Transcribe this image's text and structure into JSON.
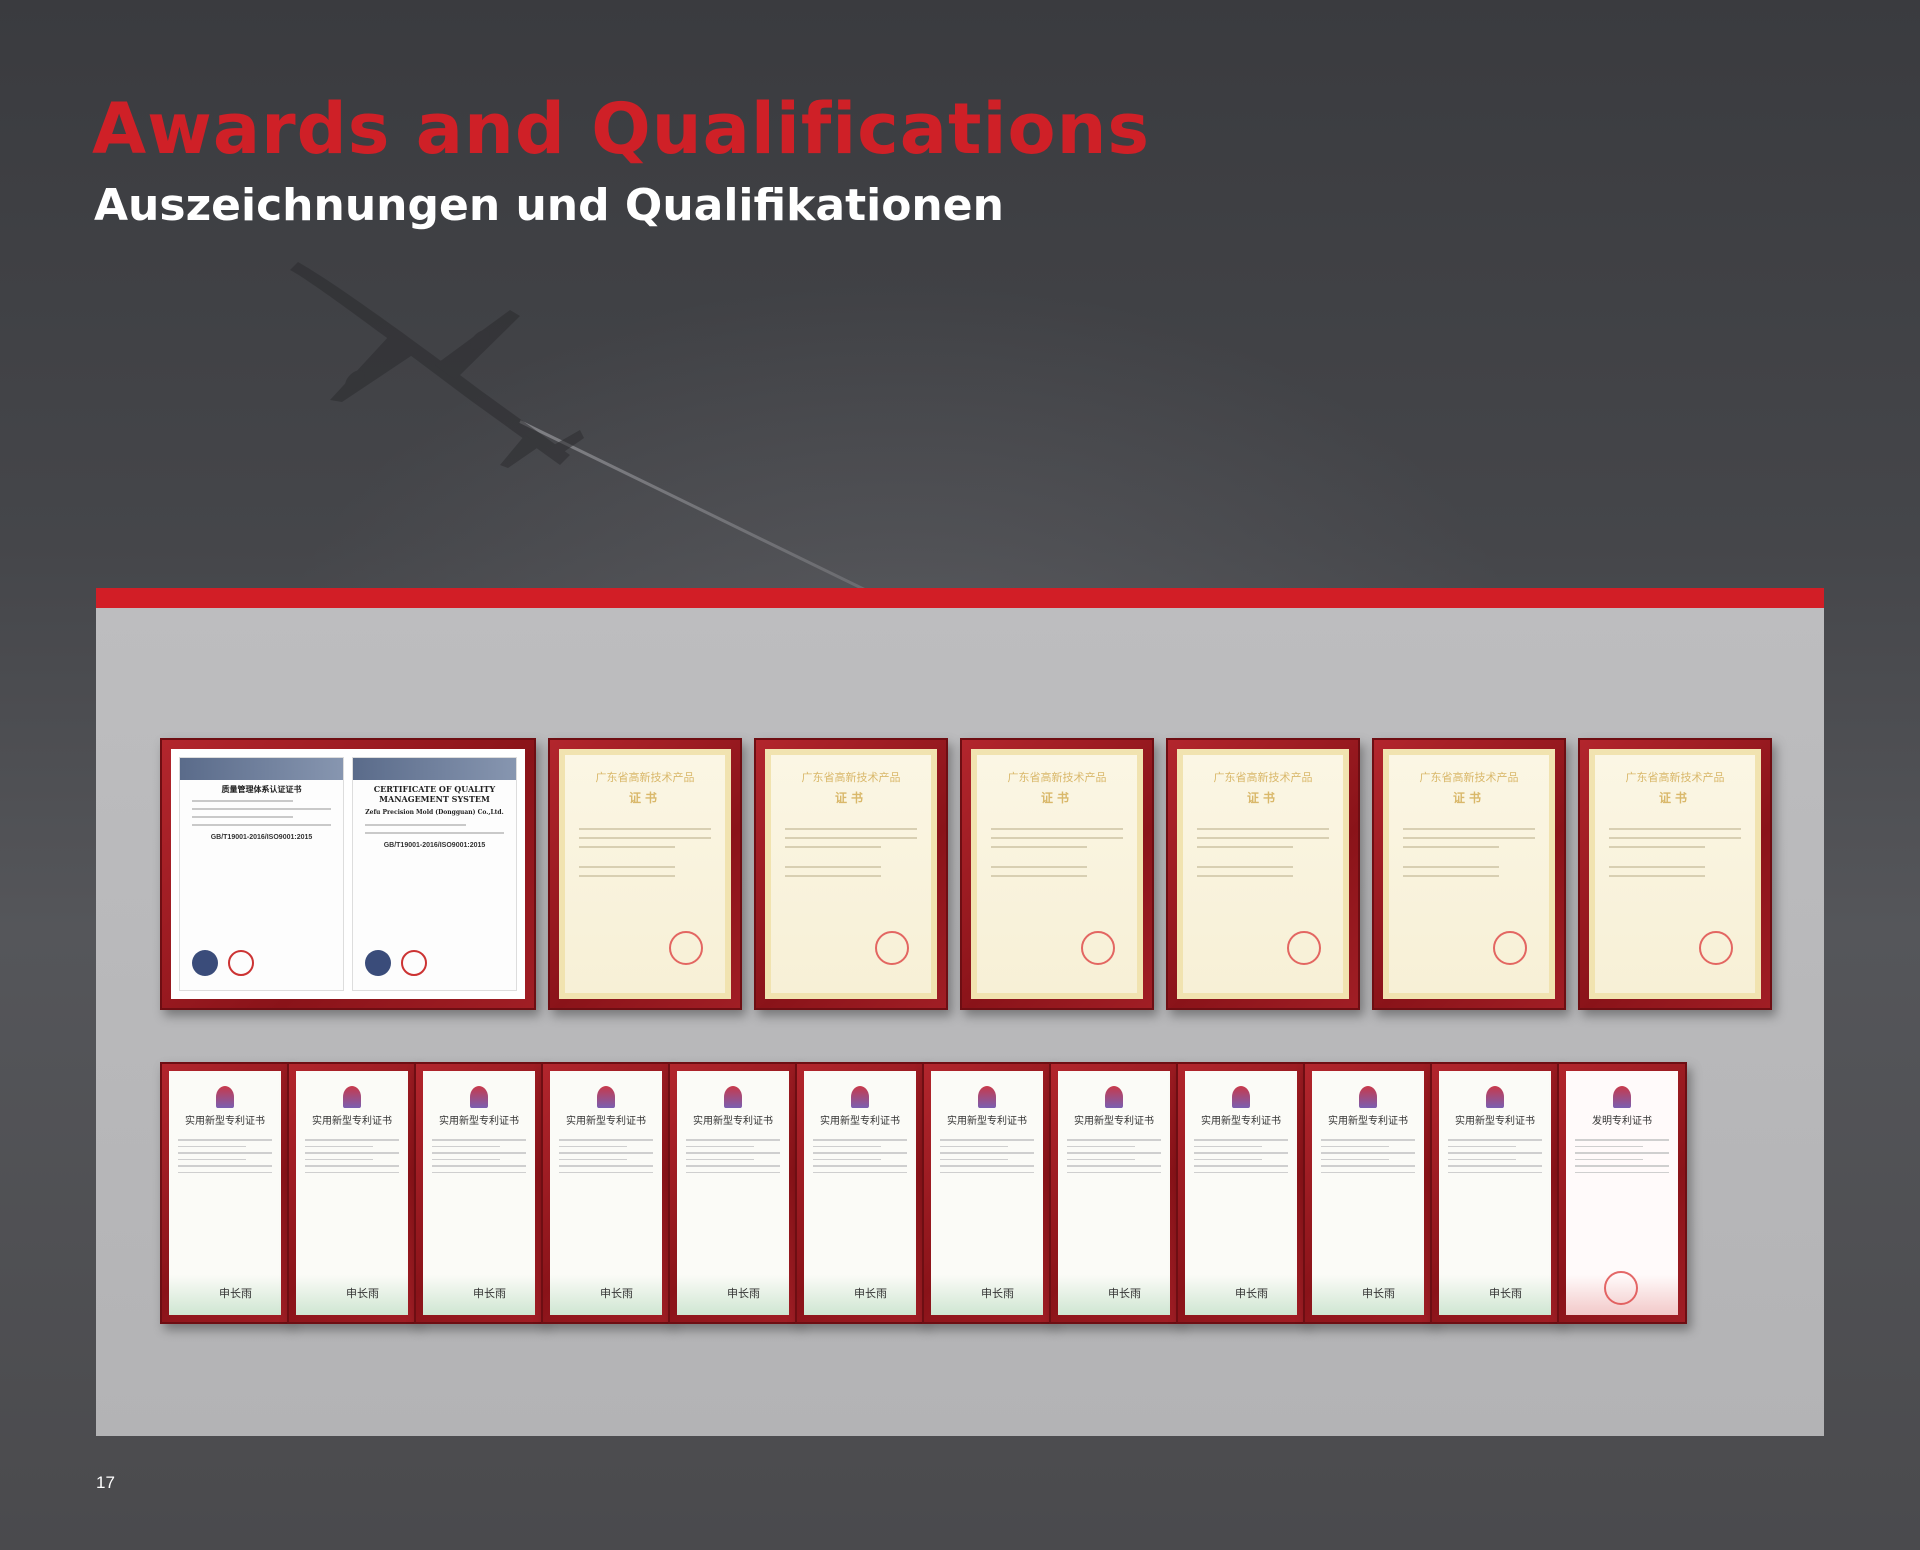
{
  "page": {
    "title": "Awards and Qualifications",
    "subtitle": "Auszeichnungen und Qualifikationen",
    "page_number": "17",
    "accent_color": "#cf2027"
  },
  "certificates": {
    "quality": {
      "cn_title": "质量管理体系认证证书",
      "en_title": "CERTIFICATE OF QUALITY MANAGEMENT SYSTEM",
      "company": "Zefu Precision Mold (Dongguan) Co.,Ltd.",
      "standard_cn": "GB/T19001-2016/ISO9001:2015",
      "standard_en": "GB/T19001-2016/ISO9001:2015"
    },
    "high_tech": [
      {
        "title": "广东省高新技术产品",
        "sub": "证书"
      },
      {
        "title": "广东省高新技术产品",
        "sub": "证书"
      },
      {
        "title": "广东省高新技术产品",
        "sub": "证书"
      },
      {
        "title": "广东省高新技术产品",
        "sub": "证书"
      },
      {
        "title": "广东省高新技术产品",
        "sub": "证书"
      },
      {
        "title": "广东省高新技术产品",
        "sub": "证书"
      }
    ],
    "patents": [
      {
        "title": "实用新型专利证书"
      },
      {
        "title": "实用新型专利证书"
      },
      {
        "title": "实用新型专利证书"
      },
      {
        "title": "实用新型专利证书"
      },
      {
        "title": "实用新型专利证书"
      },
      {
        "title": "实用新型专利证书"
      },
      {
        "title": "实用新型专利证书"
      },
      {
        "title": "实用新型专利证书"
      },
      {
        "title": "实用新型专利证书"
      },
      {
        "title": "实用新型专利证书"
      },
      {
        "title": "实用新型专利证书"
      },
      {
        "title": "发明专利证书"
      }
    ],
    "patent_signature": "申长雨"
  }
}
